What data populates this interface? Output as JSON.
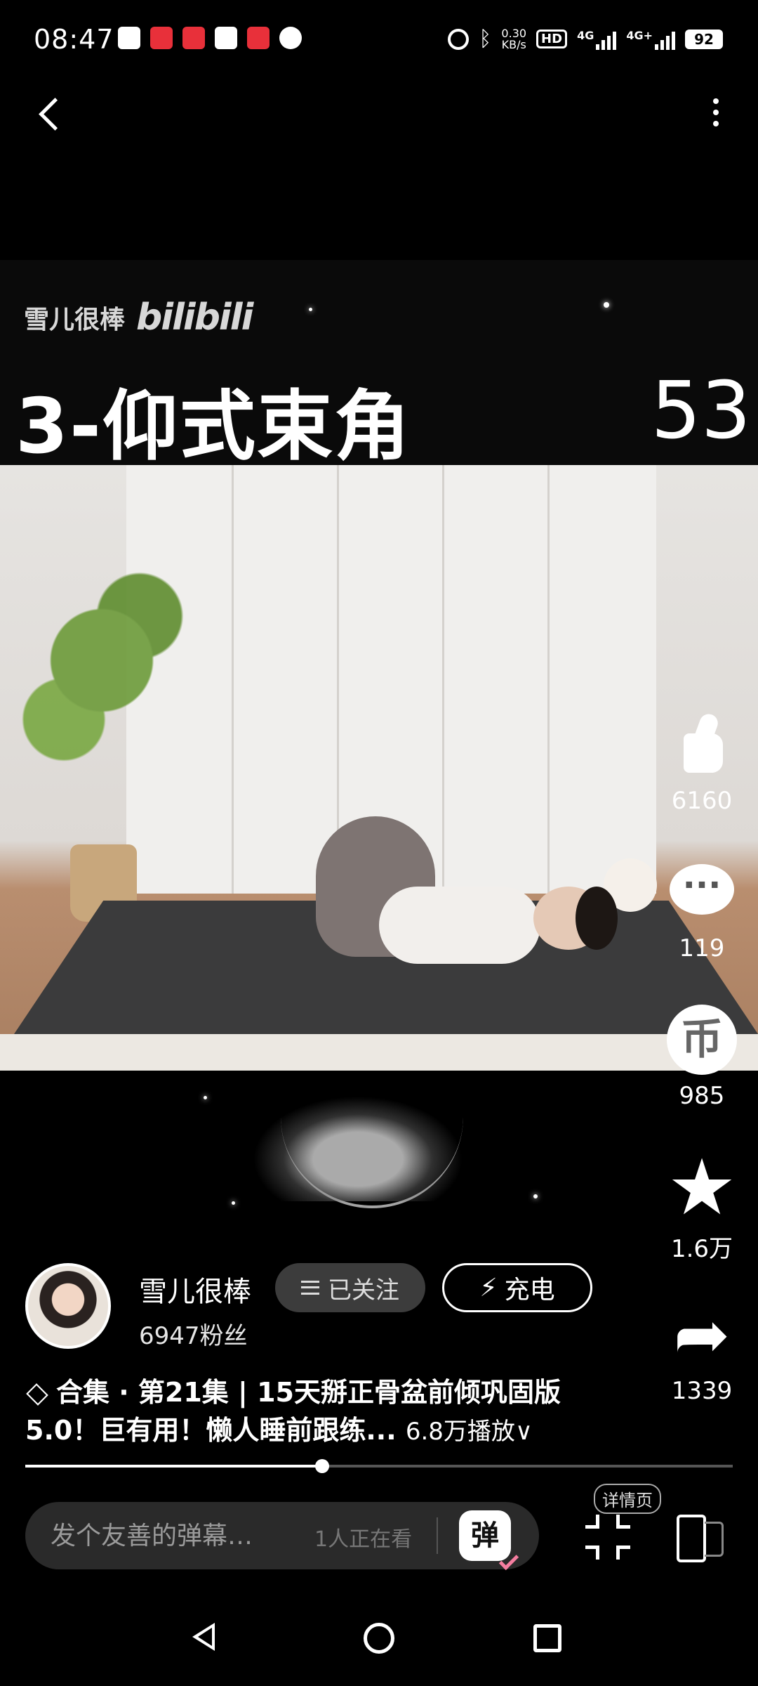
{
  "status_bar": {
    "time": "08:47",
    "net_speed_value": "0.30",
    "net_speed_unit": "KB/s",
    "hd_label": "HD",
    "signal_1": "4G",
    "signal_2": "4G+",
    "battery": "92"
  },
  "video": {
    "uploader_watermark": "雪儿很棒",
    "platform_logo": "bilibili",
    "pose_title": "3-仰式束角",
    "pose_counter": "53"
  },
  "actions": {
    "like_count": "6160",
    "comment_count": "119",
    "coin_count": "985",
    "favorite_count": "1.6万",
    "share_count": "1339",
    "coin_glyph": "币"
  },
  "uploader": {
    "name": "雪儿很棒",
    "fans": "6947粉丝",
    "follow_label": "已关注",
    "charge_label": "充电"
  },
  "description": {
    "collection_prefix": "合集 · 第21集 | 15天掰正骨盆前倾巩固版",
    "title_line2": "5.0！巨有用！懒人睡前跟练...",
    "views": "6.8万播放",
    "expand_glyph": "∨"
  },
  "playback": {
    "progress": 0.42
  },
  "bottom_bar": {
    "danmaku_placeholder": "发个友善的弹幕…",
    "watching": "1人正在看",
    "danmaku_toggle": "弹",
    "detail_label": "详情页"
  }
}
